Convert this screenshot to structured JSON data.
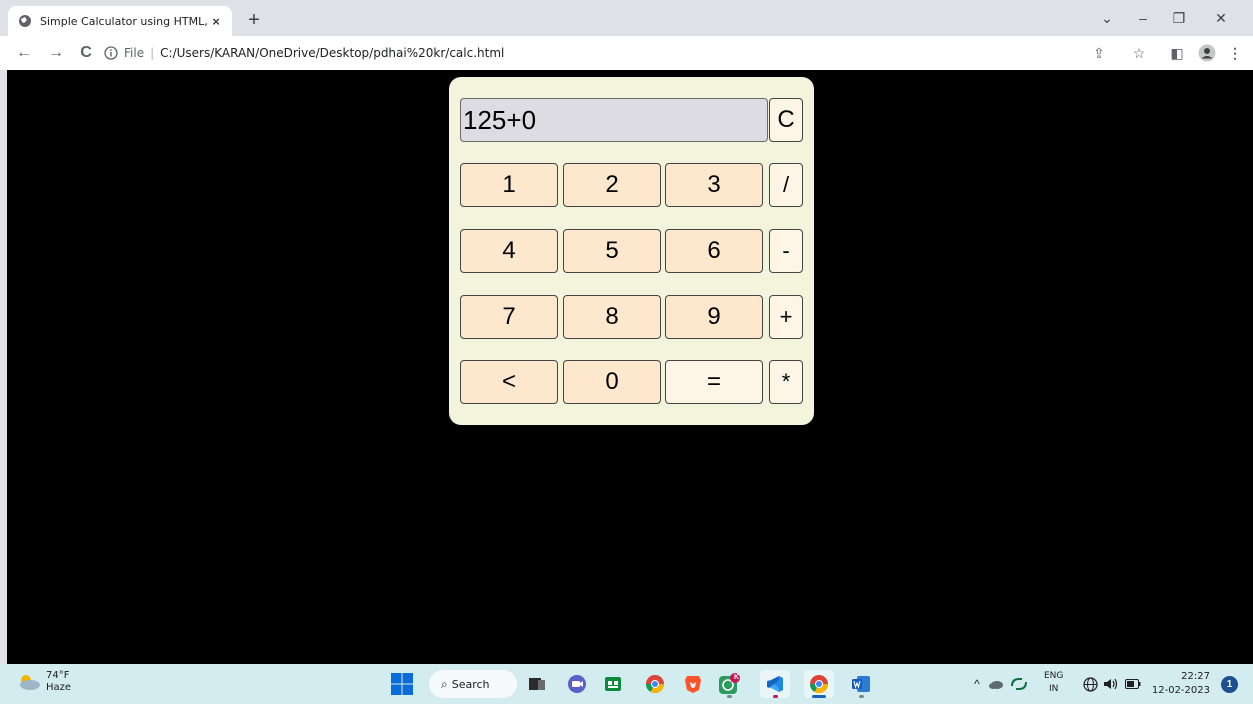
{
  "browser": {
    "tab_title": "Simple Calculator using HTML, C",
    "tab_close": "×",
    "new_tab": "+",
    "address_file_label": "File",
    "address_separator": "|",
    "address_url": "C:/Users/KARAN/OneDrive/Desktop/pdhai%20kr/calc.html",
    "window_controls": {
      "dropdown": "⌄",
      "minimize": "–",
      "restore": "❐",
      "close": "✕"
    },
    "nav": {
      "back": "←",
      "forward": "→",
      "reload": "C"
    },
    "toolbar_right": {
      "share": "⇪",
      "bookmark": "☆",
      "sidepanel": "◧",
      "profile": "●",
      "menu": "⋮"
    }
  },
  "calculator": {
    "display_value": "125+0",
    "clear_label": "C",
    "rows": [
      [
        "1",
        "2",
        "3",
        "/"
      ],
      [
        "4",
        "5",
        "6",
        "-"
      ],
      [
        "7",
        "8",
        "9",
        "+"
      ],
      [
        "<",
        "0",
        "=",
        "*"
      ]
    ]
  },
  "taskbar": {
    "weather_temp": "74°F",
    "weather_desc": "Haze",
    "search_label": "Search",
    "language_top": "ENG",
    "language_bottom": "IN",
    "time": "22:27",
    "date": "12-02-2023",
    "notification_count": "1",
    "whatsapp_badge": "K"
  },
  "colors": {
    "page_bg": "#000000",
    "calc_bg": "#f2f4dc",
    "key_bg": "#fde8cd",
    "op_bg": "#fdf6e6",
    "display_bg": "#dcdce2"
  }
}
